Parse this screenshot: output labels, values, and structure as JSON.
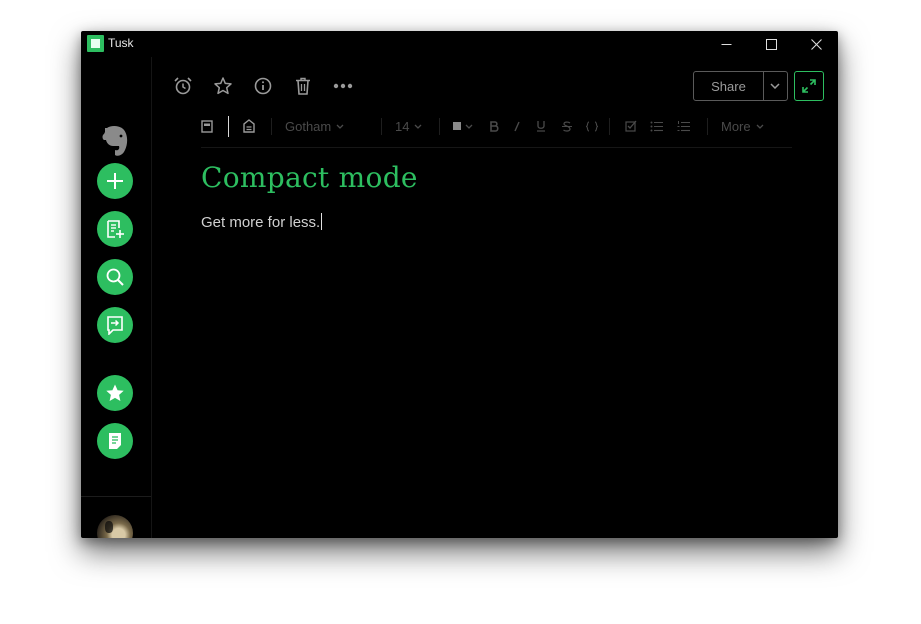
{
  "window": {
    "title": "Tusk"
  },
  "sidebar": {
    "items": [
      {
        "name": "new-note",
        "icon": "plus-icon"
      },
      {
        "name": "scratch-pad",
        "icon": "note-add-icon"
      },
      {
        "name": "search",
        "icon": "search-icon"
      },
      {
        "name": "work-chat",
        "icon": "chat-arrow-icon"
      },
      {
        "name": "shortcuts",
        "icon": "star-icon"
      },
      {
        "name": "notes",
        "icon": "notes-icon"
      }
    ]
  },
  "toolbar": {
    "share_label": "Share",
    "icons": [
      "alarm-icon",
      "star-outline-icon",
      "info-icon",
      "trash-icon",
      "more-icon"
    ]
  },
  "format": {
    "font": "Gotham",
    "size": "14",
    "more": "More"
  },
  "note": {
    "title": "Compact mode",
    "body": "Get more for less."
  },
  "colors": {
    "accent": "#2dbe60",
    "background": "#000000",
    "muted": "#4a4a4a"
  }
}
